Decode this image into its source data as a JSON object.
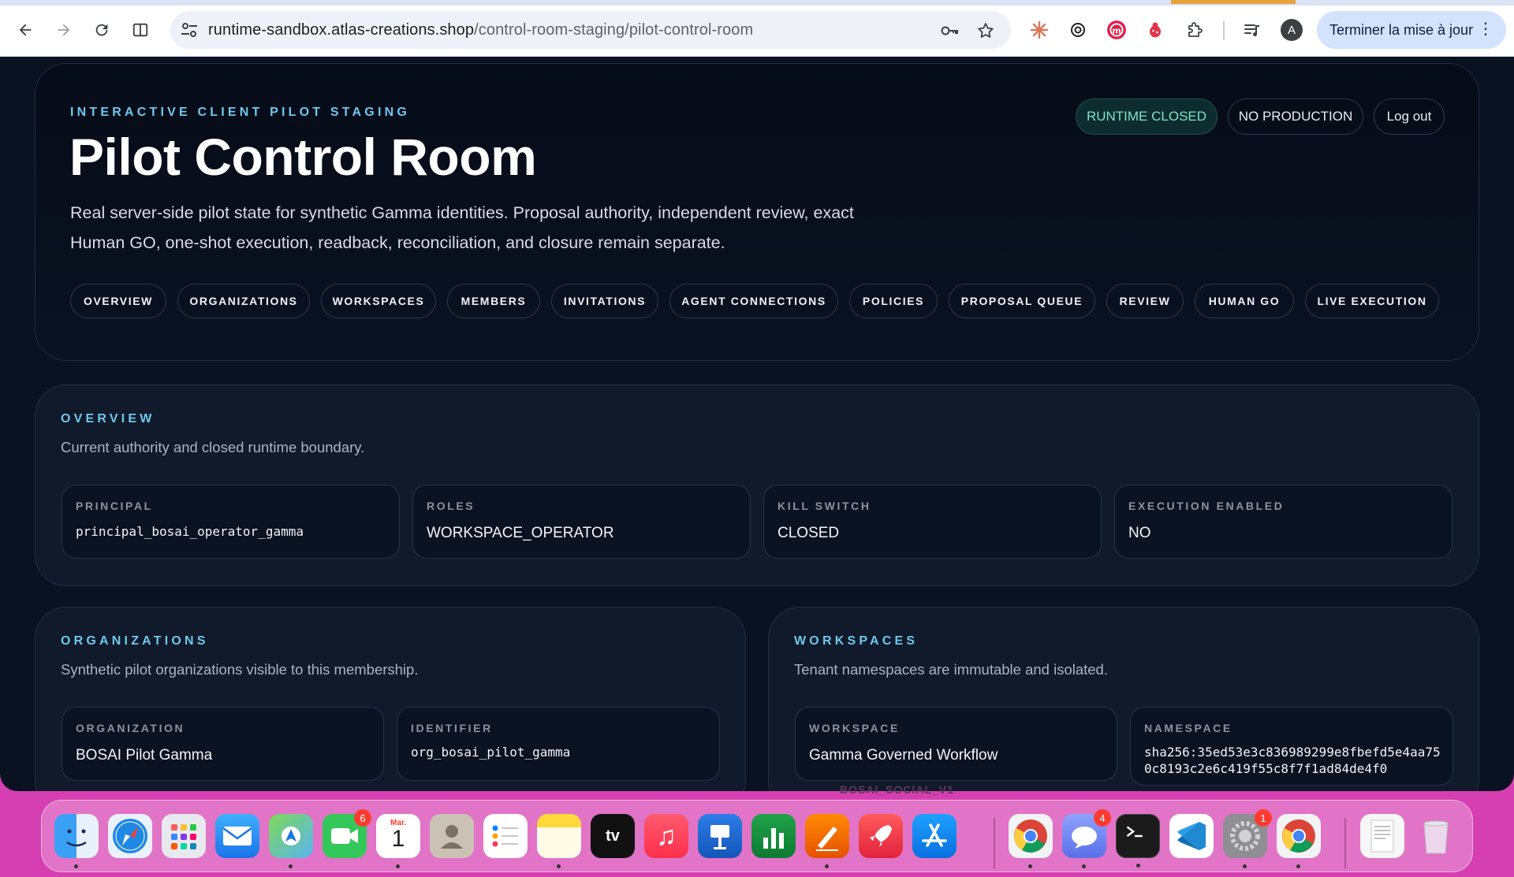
{
  "browser": {
    "url_host": "runtime-sandbox.atlas-creations.shop",
    "url_path": "/control-room-staging/pilot-control-room",
    "profile_initial": "A",
    "update_button": "Terminer la mise à jour"
  },
  "header": {
    "eyebrow": "INTERACTIVE CLIENT PILOT STAGING",
    "title": "Pilot Control Room",
    "description": "Real server-side pilot state for synthetic Gamma identities. Proposal authority, independent review, exact Human GO, one-shot execution, readback, reconciliation, and closure remain separate.",
    "status_runtime": "RUNTIME CLOSED",
    "status_production": "NO PRODUCTION",
    "logout": "Log out"
  },
  "tabs": [
    {
      "label": "OVERVIEW"
    },
    {
      "label": "ORGANIZATIONS"
    },
    {
      "label": "WORKSPACES"
    },
    {
      "label": "MEMBERS"
    },
    {
      "label": "INVITATIONS"
    },
    {
      "label": "AGENT CONNECTIONS"
    },
    {
      "label": "POLICIES"
    },
    {
      "label": "PROPOSAL QUEUE"
    },
    {
      "label": "REVIEW"
    },
    {
      "label": "HUMAN GO"
    },
    {
      "label": "LIVE EXECUTION"
    },
    {
      "label": ""
    }
  ],
  "overview": {
    "title": "OVERVIEW",
    "subtitle": "Current authority and closed runtime boundary.",
    "cards": [
      {
        "label": "PRINCIPAL",
        "value": "principal_bosai_operator_gamma"
      },
      {
        "label": "ROLES",
        "value": "WORKSPACE_OPERATOR"
      },
      {
        "label": "KILL SWITCH",
        "value": "CLOSED"
      },
      {
        "label": "EXECUTION ENABLED",
        "value": "NO"
      }
    ]
  },
  "organizations": {
    "title": "ORGANIZATIONS",
    "subtitle": "Synthetic pilot organizations visible to this membership.",
    "cards": [
      {
        "label": "ORGANIZATION",
        "value": "BOSAI Pilot Gamma"
      },
      {
        "label": "IDENTIFIER",
        "value": "org_bosai_pilot_gamma"
      }
    ]
  },
  "workspaces": {
    "title": "WORKSPACES",
    "subtitle": "Tenant namespaces are immutable and isolated.",
    "cards": [
      {
        "label": "WORKSPACE",
        "value": "Gamma Governed Workflow"
      },
      {
        "label": "NAMESPACE",
        "value": "sha256:35ed53e3c836989299e8fbefd5e4aa750c8193c2e6c419f55c8f7f1ad84de4f0"
      }
    ]
  },
  "peek_text": "BOSAI_SOCIAL_V1",
  "dock": {
    "badges": {
      "facetime": "6",
      "calendar_month": "Mar.",
      "calendar_day": "1",
      "pilot_app": "4",
      "settings": "1"
    }
  }
}
